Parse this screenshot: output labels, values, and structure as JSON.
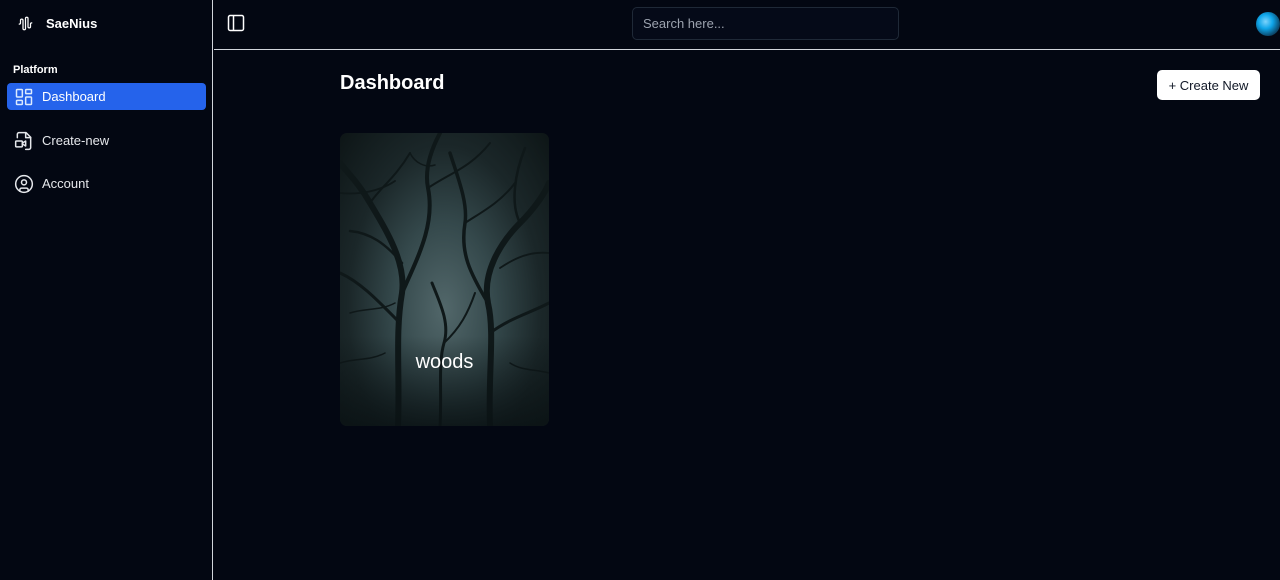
{
  "app": {
    "name": "SaeNius",
    "logo_icon": "audio-waveform-icon"
  },
  "sidebar": {
    "section_label": "Platform",
    "items": [
      {
        "label": "Dashboard",
        "icon": "layout-dashboard-icon",
        "active": true
      },
      {
        "label": "Create-new",
        "icon": "file-video-icon",
        "active": false
      },
      {
        "label": "Account",
        "icon": "user-circle-icon",
        "active": false
      }
    ]
  },
  "topbar": {
    "toggle_icon": "panel-left-icon",
    "search_placeholder": "Search here..."
  },
  "main": {
    "title": "Dashboard",
    "create_button_label": "+ Create New",
    "cards": [
      {
        "title": "woods",
        "image": "dark-foggy-forest-thumbnail"
      }
    ]
  },
  "colors": {
    "background": "#030712",
    "accent": "#2563eb",
    "divider": "#d1d5db",
    "button_bg": "#ffffff"
  }
}
